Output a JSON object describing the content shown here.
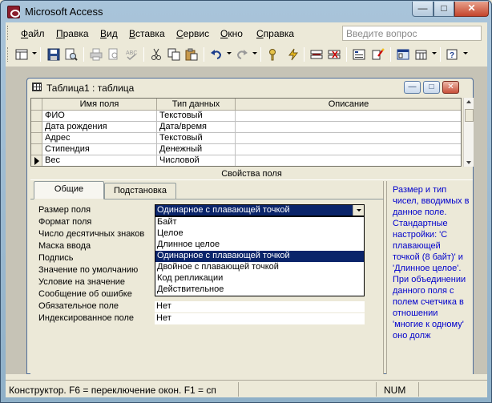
{
  "window": {
    "title": "Microsoft Access"
  },
  "menubar": {
    "items": [
      "Файл",
      "Правка",
      "Вид",
      "Вставка",
      "Сервис",
      "Окно",
      "Справка"
    ],
    "ask_placeholder": "Введите вопрос"
  },
  "child_window": {
    "title": "Таблица1 : таблица"
  },
  "fields_grid": {
    "headers": [
      "Имя поля",
      "Тип данных",
      "Описание"
    ],
    "rows": [
      {
        "name": "ФИО",
        "type": "Текстовый",
        "description": ""
      },
      {
        "name": "Дата рождения",
        "type": "Дата/время",
        "description": ""
      },
      {
        "name": "Адрес",
        "type": "Текстовый",
        "description": ""
      },
      {
        "name": "Стипендия",
        "type": "Денежный",
        "description": ""
      },
      {
        "name": "Вес",
        "type": "Числовой",
        "description": ""
      }
    ],
    "current_row": 4
  },
  "properties": {
    "band_label": "Свойства поля",
    "tabs": [
      "Общие",
      "Подстановка"
    ],
    "active_tab": 0,
    "labels": [
      "Размер поля",
      "Формат поля",
      "Число десятичных знаков",
      "Маска ввода",
      "Подпись",
      "Значение по умолчанию",
      "Условие на значение",
      "Сообщение об ошибке",
      "Обязательное поле",
      "Индексированное поле"
    ],
    "field_size_value": "Одинарное с плавающей точкой",
    "required_value": "Нет",
    "indexed_value": "Нет",
    "dropdown_options": [
      "Байт",
      "Целое",
      "Длинное целое",
      "Одинарное с плавающей точкой",
      "Двойное с плавающей точкой",
      "Код репликации",
      "Действительное"
    ],
    "dropdown_selected": 3
  },
  "help_text": "Размер и тип чисел, вводимых в данное поле. Стандартные настройки: 'С плавающей точкой (8 байт)' и 'Длинное целое'. При объединении данного поля с полем счетчика в отношении 'многие к одному' оно долж",
  "statusbar": {
    "text": "Конструктор.  F6 = переключение окон.  F1 = сп",
    "num": "NUM"
  },
  "icons": [
    "view-icon",
    "save-icon",
    "search-file-icon",
    "print-icon",
    "print-preview-icon",
    "spelling-icon",
    "cut-icon",
    "copy-icon",
    "paste-icon",
    "undo-icon",
    "redo-icon",
    "primary-key-icon",
    "indexes-icon",
    "insert-rows-icon",
    "delete-rows-icon",
    "properties-icon",
    "build-icon",
    "database-window-icon",
    "new-object-icon",
    "help-icon"
  ]
}
